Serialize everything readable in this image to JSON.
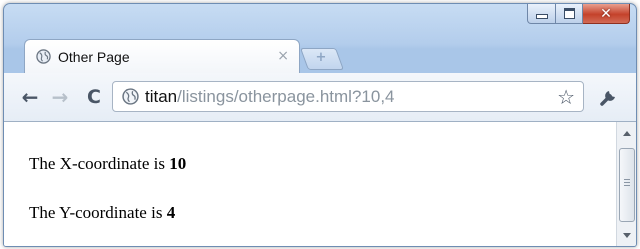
{
  "window": {
    "controls": {
      "minimize_icon": "minimize-icon",
      "maximize_icon": "maximize-icon",
      "close_icon": "close-icon",
      "close_glyph": "✕"
    }
  },
  "tab": {
    "title": "Other Page",
    "close_glyph": "×",
    "favicon": "globe-icon"
  },
  "newtab": {
    "glyph": "+"
  },
  "toolbar": {
    "back_glyph": "←",
    "forward_glyph": "→",
    "reload_glyph": "C",
    "url_host": "titan",
    "url_path": "/listings/otherpage.html?10,4",
    "star_glyph": "☆",
    "wrench_icon": "wrench-icon"
  },
  "content": {
    "x_label": "The X-coordinate is ",
    "x_value": "10",
    "y_label": "The Y-coordinate is ",
    "y_value": "4"
  },
  "colors": {
    "frame": "#b3cdec",
    "close_button": "#c4422b",
    "text": "#000000",
    "url_path": "#8a949e"
  }
}
